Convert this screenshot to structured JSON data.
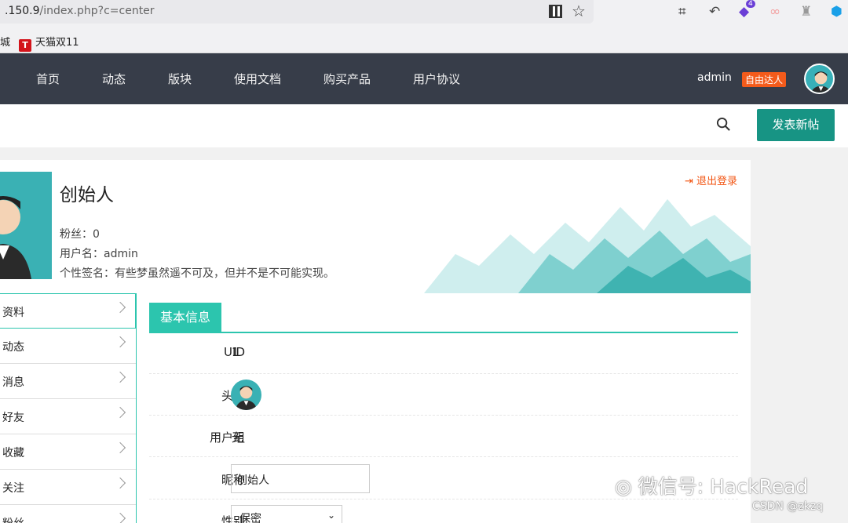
{
  "browser": {
    "url_host": ".150.9",
    "url_path": "/index.php?c=center",
    "bookmarks": [
      "城",
      "天猫双11"
    ],
    "ext_badge": "4"
  },
  "nav": {
    "items": [
      "首页",
      "动态",
      "版块",
      "使用文档",
      "购买产品",
      "用户协议"
    ],
    "username": "admin",
    "badge": "自由达人"
  },
  "toolbar": {
    "post_button": "发表新帖"
  },
  "profile": {
    "name": "创始人",
    "fans": "粉丝：0",
    "username_line": "用户名：admin",
    "signature": "个性签名：有些梦虽然遥不可及，但并不是不可能实现。",
    "logout": "退出登录"
  },
  "sidebar": {
    "items": [
      "资料",
      "动态",
      "消息",
      "好友",
      "收藏",
      "关注",
      "粉丝"
    ]
  },
  "main": {
    "tab": "基本信息",
    "uid_label": "UID",
    "uid_value": "1",
    "avatar_label": "头像",
    "group_label": "用户组",
    "group_value": "无",
    "nickname_label": "昵称",
    "nickname_value": "创始人",
    "gender_label": "性别",
    "gender_value": "保密"
  },
  "watermark": {
    "wechat": "微信号: HackRead",
    "csdn": "CSDN @zkzq"
  },
  "colors": {
    "nav_bg": "#373d49",
    "accent": "#2cc5ae",
    "post_button": "#179484",
    "badge": "#f35b1b"
  }
}
